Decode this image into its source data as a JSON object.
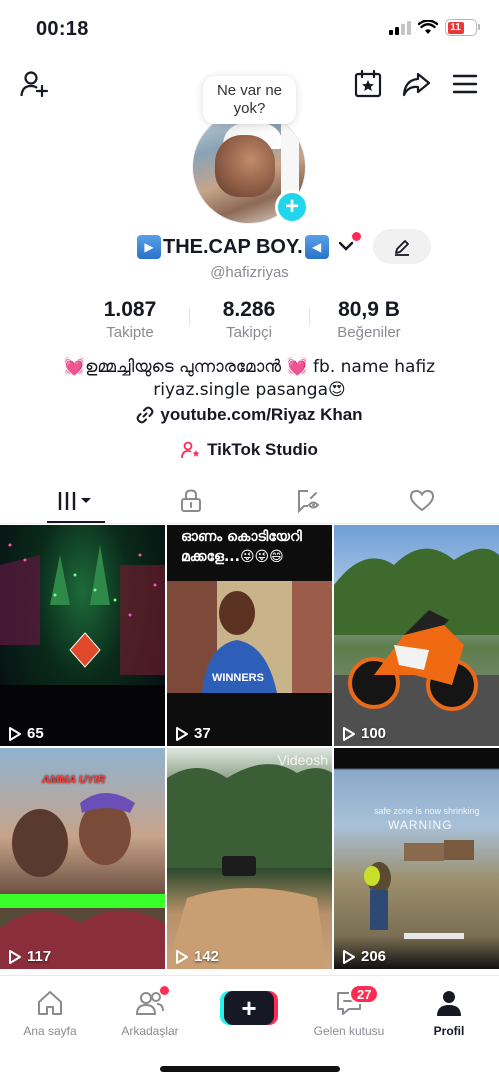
{
  "status_bar": {
    "time": "00:18",
    "battery": "11"
  },
  "header": {
    "add_friend_icon": "person-plus-icon",
    "calendar_icon": "calendar-star-icon",
    "share_icon": "share-arrow-icon",
    "menu_icon": "hamburger-menu-icon"
  },
  "bubble": {
    "text": "Ne var ne yok?"
  },
  "profile": {
    "display_name": "THE.CAP BOY.",
    "username": "@hafizriyas"
  },
  "stats": [
    {
      "value": "1.087",
      "label": "Takipte"
    },
    {
      "value": "8.286",
      "label": "Takipçi"
    },
    {
      "value": "80,9 B",
      "label": "Beğeniler"
    }
  ],
  "bio": {
    "text": "💓ഉമ്മച്ചിയുടെ പുന്നാരമോൻ 💓 fb. name hafiz riyaz.single pasanga😍",
    "link": "youtube.com/Riyaz Khan",
    "studio": "TikTok Studio"
  },
  "tabs": [
    "videos-grid-icon",
    "lock-icon",
    "repost-eye-icon",
    "heart-icon"
  ],
  "videos": [
    {
      "views": "65",
      "overlay": ""
    },
    {
      "views": "37",
      "overlay": "ഓണം കൊടിയേറി മക്കളേ...😜😜😄"
    },
    {
      "views": "100",
      "overlay": ""
    },
    {
      "views": "117",
      "overlay": "AMMA UYIR"
    },
    {
      "views": "142",
      "overlay": "Videosh"
    },
    {
      "views": "206",
      "overlay": "WARNING"
    }
  ],
  "bottom_nav": {
    "home": "Ana sayfa",
    "friends": "Arkadaşlar",
    "inbox": "Gelen kutusu",
    "inbox_badge": "27",
    "profile": "Profil"
  }
}
